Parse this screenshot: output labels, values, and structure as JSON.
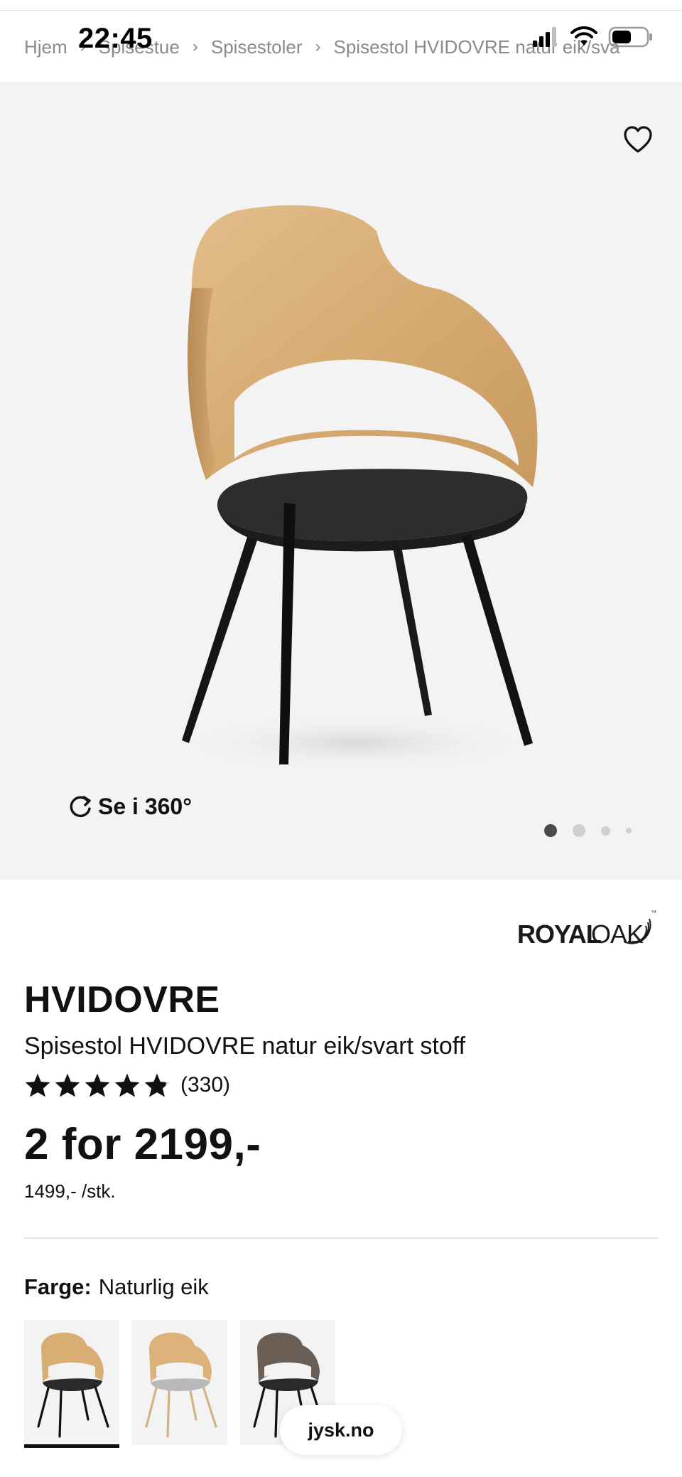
{
  "status_bar": {
    "time": "22:45"
  },
  "breadcrumb": [
    "Hjem",
    "Spisestue",
    "Spisestoler",
    "Spisestol HVIDOVRE natur eik/sva"
  ],
  "gallery": {
    "rotate_label": "Se i 360°",
    "dots": 4,
    "active_dot": 0
  },
  "brand": {
    "name_royal": "ROYAL",
    "name_oak": "OAK",
    "trademark": "™"
  },
  "product": {
    "title": "HVIDOVRE",
    "subtitle": "Spisestol HVIDOVRE natur eik/svart stoff",
    "rating_stars": 4.5,
    "rating_count": "(330)",
    "price": "2 for 2199,-",
    "unit_price": "1499,- /stk."
  },
  "color": {
    "label": "Farge:",
    "value": "Naturlig eik",
    "options": [
      {
        "name": "natur eik/svart",
        "selected": true
      },
      {
        "name": "natur eik/grå",
        "selected": false
      },
      {
        "name": "mørk/svart",
        "selected": false
      }
    ]
  },
  "browser": {
    "domain": "jysk.no"
  }
}
